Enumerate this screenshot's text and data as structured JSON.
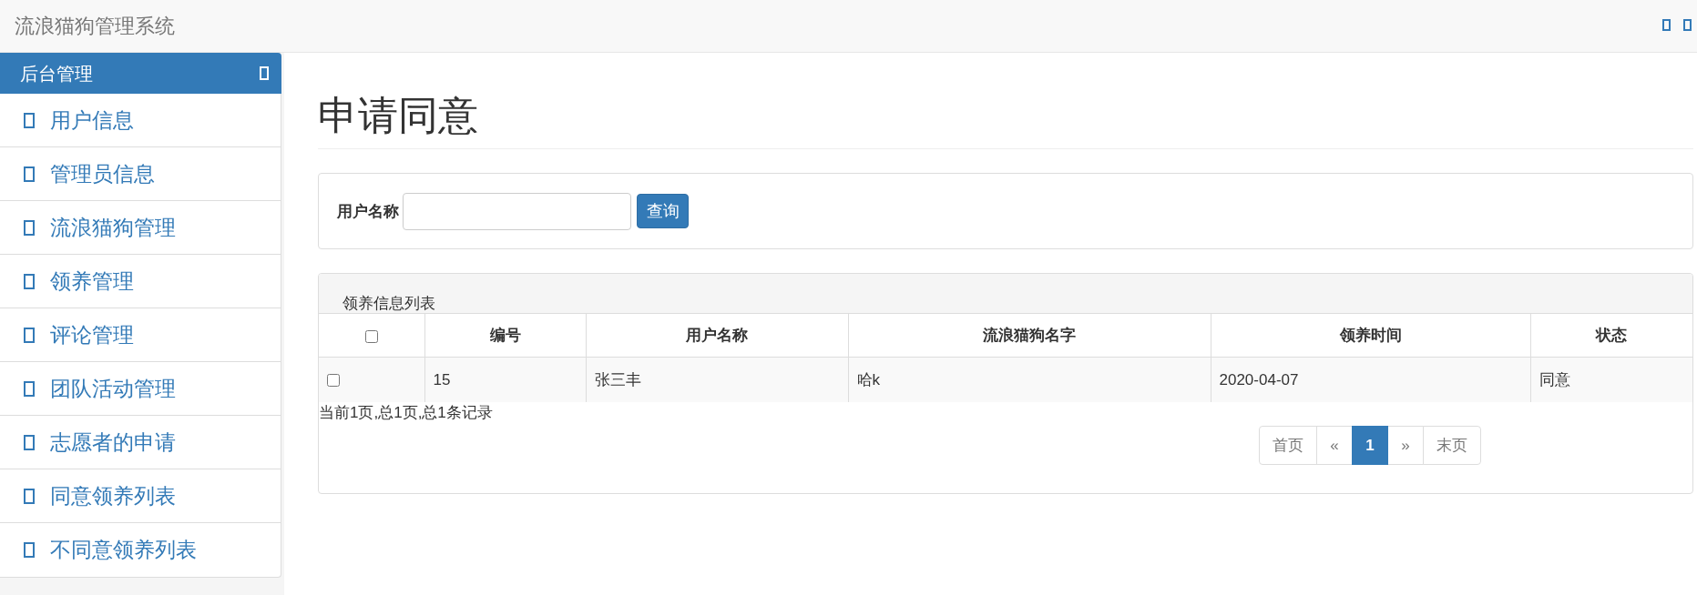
{
  "navbar": {
    "title": "流浪猫狗管理系统"
  },
  "sidebar": {
    "title": "后台管理",
    "items": [
      "用户信息",
      "管理员信息",
      "流浪猫狗管理",
      "领养管理",
      "评论管理",
      "团队活动管理",
      "志愿者的申请",
      "同意领养列表",
      "不同意领养列表"
    ]
  },
  "page": {
    "heading": "申请同意"
  },
  "search": {
    "label": "用户名称",
    "button": "查询"
  },
  "list_panel": {
    "title": "领养信息列表",
    "table": {
      "select_all": {
        "checked": false
      },
      "columns": [
        "编号",
        "用户名称",
        "流浪猫狗名字",
        "领养时间",
        "状态"
      ],
      "rows": [
        {
          "checked": false,
          "cells": [
            "15",
            "张三丰",
            "哈k",
            "2020-04-07",
            "同意"
          ]
        }
      ]
    },
    "summary": "当前1页,总1页,总1条记录",
    "pagination": [
      {
        "label": "首页",
        "selected": false
      },
      {
        "label": "«",
        "selected": false
      },
      {
        "label": "1",
        "selected": true
      },
      {
        "label": "»",
        "selected": false
      },
      {
        "label": "末页",
        "selected": false
      }
    ]
  }
}
